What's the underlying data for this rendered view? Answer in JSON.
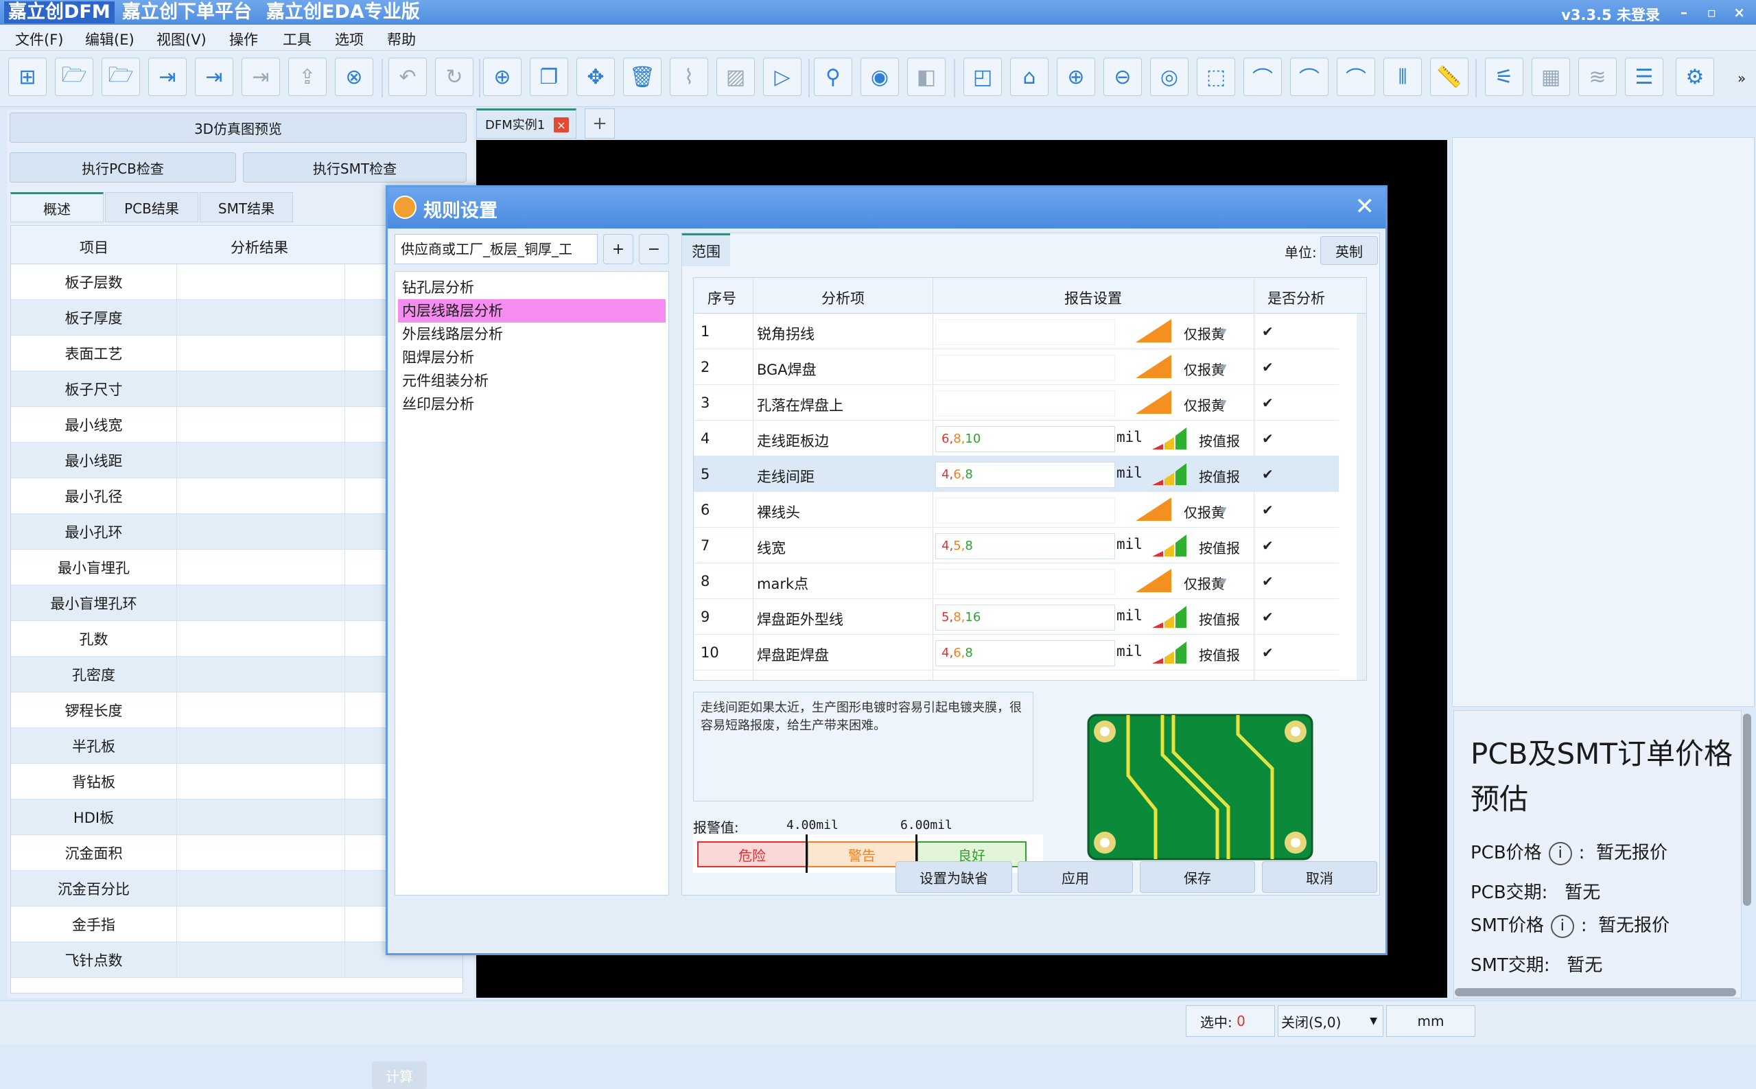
{
  "titlebar": {
    "seg1": "嘉立创DFM",
    "seg2": "嘉立创下单平台",
    "seg3": "嘉立创EDA专业版",
    "version": "v3.3.5 未登录"
  },
  "menu": [
    "文件(F)",
    "编辑(E)",
    "视图(V)",
    "操作",
    "工具",
    "选项",
    "帮助"
  ],
  "left": {
    "preview_btn": "3D仿真图预览",
    "pcb_check_btn": "执行PCB检查",
    "smt_check_btn": "执行SMT检查",
    "tabs": [
      "概述",
      "PCB结果",
      "SMT结果"
    ],
    "col_item": "项目",
    "col_result": "分析结果",
    "rows": [
      "板子层数",
      "板子厚度",
      "表面工艺",
      "板子尺寸",
      "最小线宽",
      "最小线距",
      "最小孔径",
      "最小孔环",
      "最小盲埋孔",
      "最小盲埋孔环",
      "孔数",
      "孔密度",
      "锣程长度",
      "半孔板",
      "背钻板",
      "HDI板",
      "沉金面积",
      "沉金百分比",
      "金手指",
      "飞针点数"
    ],
    "calc_btn": "计算"
  },
  "doc_tab": "DFM实例1",
  "price": {
    "title": "PCB及SMT订单价格预估",
    "pcb_price_label": "PCB价格",
    "pcb_price": "暂无报价",
    "pcb_lead_label": "PCB交期:",
    "pcb_lead": "暂无",
    "smt_price_label": "SMT价格",
    "smt_price": "暂无报价",
    "smt_lead_label": "SMT交期:",
    "smt_lead": "暂无",
    "colon": ":"
  },
  "status": {
    "selected_label": "选中:",
    "selected_value": "0",
    "close_label": "关闭(S,0)",
    "unit": "mm"
  },
  "dialog": {
    "title": "规则设置",
    "supplier_select": "供应商或工厂_板层_铜厚_工",
    "categories": [
      "钻孔层分析",
      "内层线路层分析",
      "外层线路层分析",
      "阻焊层分析",
      "元件组装分析",
      "丝印层分析"
    ],
    "range_tab": "范围",
    "unit_label": "单位:",
    "unit_btn": "英制",
    "headers": {
      "seq": "序号",
      "item": "分析项",
      "report": "报告设置",
      "analyze": "是否分析"
    },
    "rows": [
      {
        "n": "1",
        "name": "锐角拐线",
        "v": [
          "",
          "",
          ""
        ],
        "unit": "",
        "mode": "仅报黄",
        "type": "tri"
      },
      {
        "n": "2",
        "name": "BGA焊盘",
        "v": [
          "",
          "",
          ""
        ],
        "unit": "",
        "mode": "仅报黄",
        "type": "tri"
      },
      {
        "n": "3",
        "name": "孔落在焊盘上",
        "v": [
          "",
          "",
          ""
        ],
        "unit": "",
        "mode": "仅报黄",
        "type": "tri"
      },
      {
        "n": "4",
        "name": "走线距板边",
        "v": [
          "6",
          "8",
          "10"
        ],
        "unit": "mil",
        "mode": "按值报",
        "type": "bar"
      },
      {
        "n": "5",
        "name": "走线间距",
        "v": [
          "4",
          "6",
          "8"
        ],
        "unit": "mil",
        "mode": "按值报",
        "type": "bar"
      },
      {
        "n": "6",
        "name": "裸线头",
        "v": [
          "",
          "",
          ""
        ],
        "unit": "",
        "mode": "仅报黄",
        "type": "tri"
      },
      {
        "n": "7",
        "name": "线宽",
        "v": [
          "4",
          "5",
          "8"
        ],
        "unit": "mil",
        "mode": "按值报",
        "type": "bar"
      },
      {
        "n": "8",
        "name": "mark点",
        "v": [
          "",
          "",
          ""
        ],
        "unit": "",
        "mode": "仅报黄",
        "type": "tri"
      },
      {
        "n": "9",
        "name": "焊盘距外型线",
        "v": [
          "5",
          "8",
          "16"
        ],
        "unit": "mil",
        "mode": "按值报",
        "type": "bar"
      },
      {
        "n": "10",
        "name": "焊盘距焊盘",
        "v": [
          "4",
          "6",
          "8"
        ],
        "unit": "mil",
        "mode": "按值报",
        "type": "bar"
      }
    ],
    "description": "走线间距如果太近，生产图形电镀时容易引起电镀夹膜，很容易短路报废，给生产带来困难。",
    "warn_label": "报警值:",
    "warn_v1": "4.00mil",
    "warn_v2": "6.00mil",
    "levels": [
      "危险",
      "警告",
      "良好"
    ],
    "buttons": [
      "设置为缺省",
      "应用",
      "保存",
      "取消"
    ]
  },
  "colors": {
    "accent": "#4a8ae0",
    "selected_category": "#f78cf0",
    "danger": "#e03030",
    "warning": "#f08020",
    "good": "#30a030"
  }
}
